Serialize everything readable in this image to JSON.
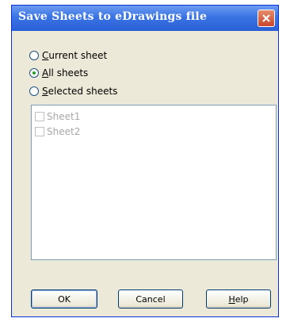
{
  "window": {
    "title": "Save Sheets to eDrawings file"
  },
  "options": [
    {
      "label": "Current sheet",
      "checked": false
    },
    {
      "label": "All sheets",
      "checked": true
    },
    {
      "label": "Selected sheets",
      "checked": false
    }
  ],
  "sheets": [
    {
      "label": "Sheet1",
      "checked": false
    },
    {
      "label": "Sheet2",
      "checked": false
    }
  ],
  "buttons": {
    "ok_label": "OK",
    "cancel_label": "Cancel",
    "help_label": "Help"
  },
  "icons": {
    "close": "close-icon"
  },
  "colors": {
    "titlebar": "#2a5fd6",
    "close_button": "#c9452b",
    "dialog_background": "#ece9d8",
    "radio_selected": "#21a121"
  }
}
